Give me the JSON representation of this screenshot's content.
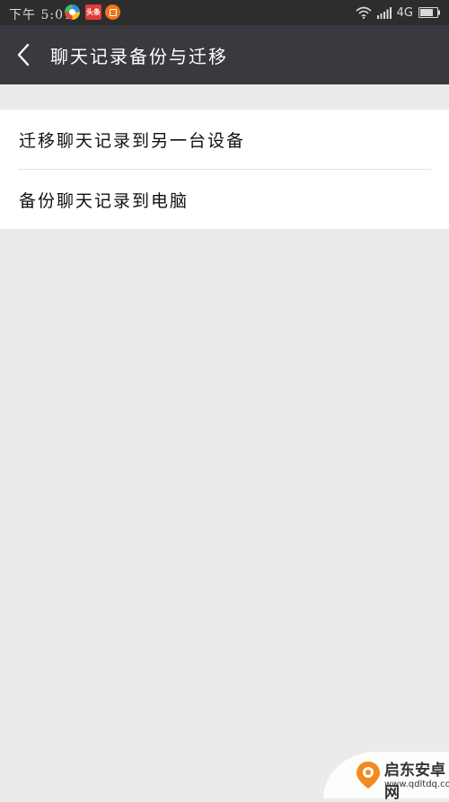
{
  "status_bar": {
    "time": "下午 5:01",
    "app_icons": [
      "browser-icon",
      "news-icon",
      "orange-app-icon"
    ],
    "news_badge_text": "头条",
    "network": "4G",
    "icons": [
      "wifi-icon",
      "signal-icon",
      "battery-icon"
    ]
  },
  "header": {
    "back_icon": "chevron-left-icon",
    "title": "聊天记录备份与迁移",
    "background": "#393a3f"
  },
  "menu": {
    "items": [
      {
        "label": "迁移聊天记录到另一台设备"
      },
      {
        "label": "备份聊天记录到电脑"
      }
    ]
  },
  "watermark": {
    "name": "启东安卓网",
    "url": "www.qdltdq.com"
  },
  "colors": {
    "page_background": "#ebebeb",
    "status_bar": "#2d2d2d",
    "list_background": "#ffffff",
    "watermark_accent": "#f28a1e"
  }
}
